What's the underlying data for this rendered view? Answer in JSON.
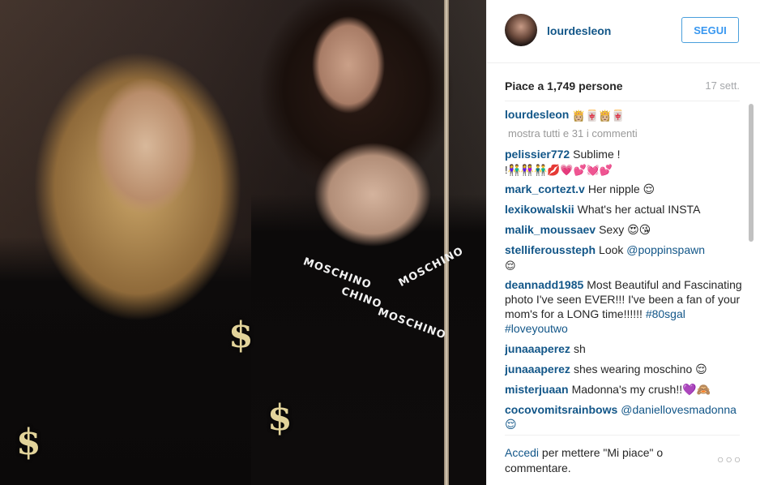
{
  "post": {
    "username": "lourdesleon",
    "follow_label": "SEGUI",
    "likes": "Piace a 1,749 persone",
    "time": "17 sett.",
    "caption": {
      "user": "lourdesleon",
      "text": "👸🏼🀄👸🏼🀄"
    },
    "show_all": "mostra tutti e 31 i commenti",
    "comments": [
      {
        "user": "pelissier772",
        "text": "Sublime !",
        "line2": "!👫👭👬💋💗💕💓💕"
      },
      {
        "user": "mark_cortezt.v",
        "text": "Her nipple 😌"
      },
      {
        "user": "lexikowalskii",
        "text": "What's her actual INSTA"
      },
      {
        "user": "malik_moussaev",
        "text": "Sexy 😍😘"
      },
      {
        "user": "stelliferoussteph",
        "text": "Look ",
        "tag": "@poppinspawn",
        "line2": "😌"
      },
      {
        "user": "deannadd1985",
        "text": "Most Beautiful and Fascinating photo I've seen EVER!!! I've been a fan of your mom's for a LONG time!!!!!! ",
        "tag": "#80sgal #loveyoutwo"
      },
      {
        "user": "junaaaperez",
        "text": "sh"
      },
      {
        "user": "junaaaperez",
        "text": "shes wearing moschino 😌"
      },
      {
        "user": "misterjuaan",
        "text": "Madonna's my crush!!💜🙈"
      },
      {
        "user": "cocovomitsrainbows",
        "text": "",
        "tag": "@daniellovesmadonna 😌"
      }
    ],
    "footer": {
      "login": "Accedi",
      "text": " per mettere \"Mi piace\" o commentare."
    },
    "more_icon": "more-options-icon"
  },
  "photo": {
    "dollar_glyph": "$",
    "brand_text": "MOSCHINO",
    "brand_text_2": "CHINO"
  }
}
